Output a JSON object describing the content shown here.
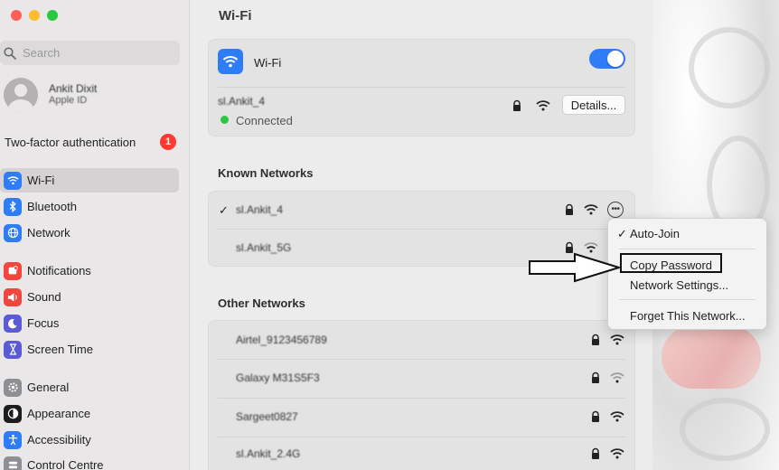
{
  "sidebar": {
    "search_placeholder": "Search",
    "profile": {
      "name": "Ankit Dixit",
      "subtitle": "Apple ID"
    },
    "two_factor": {
      "label": "Two-factor authentication",
      "badge": "1"
    },
    "items": [
      {
        "label": "Wi-Fi",
        "icon": "wifi-icon",
        "color": "#2f7df6"
      },
      {
        "label": "Bluetooth",
        "icon": "bluetooth-icon",
        "color": "#2f7df6"
      },
      {
        "label": "Network",
        "icon": "globe-icon",
        "color": "#2f7df6"
      },
      {
        "label": "Notifications",
        "icon": "bell-icon",
        "color": "#f0463e"
      },
      {
        "label": "Sound",
        "icon": "speaker-icon",
        "color": "#f0463e"
      },
      {
        "label": "Focus",
        "icon": "moon-icon",
        "color": "#5b5bd6"
      },
      {
        "label": "Screen Time",
        "icon": "hourglass-icon",
        "color": "#5b5bd6"
      },
      {
        "label": "General",
        "icon": "gear-icon",
        "color": "#8e8e93"
      },
      {
        "label": "Appearance",
        "icon": "appearance-icon",
        "color": "#1c1c1e"
      },
      {
        "label": "Accessibility",
        "icon": "accessibility-icon",
        "color": "#2f7df6"
      },
      {
        "label": "Control Centre",
        "icon": "control-centre-icon",
        "color": "#8e8e93"
      }
    ]
  },
  "main": {
    "title": "Wi-Fi",
    "wifi_toggle_label": "Wi-Fi",
    "wifi_enabled": true,
    "current_network": {
      "name": "sl.Ankit_4",
      "status": "Connected",
      "details_label": "Details..."
    },
    "known_networks_heading": "Known Networks",
    "known_networks": [
      {
        "name": "sl.Ankit_4",
        "checked": true
      },
      {
        "name": "sl.Ankit_5G",
        "checked": false
      }
    ],
    "other_networks_heading": "Other Networks",
    "other_networks": [
      {
        "name": "Airtel_9123456789"
      },
      {
        "name": "Galaxy M31S5F3"
      },
      {
        "name": "Sargeet0827"
      },
      {
        "name": "sl.Ankit_2.4G"
      }
    ]
  },
  "context_menu": {
    "items": [
      {
        "label": "Auto-Join",
        "checked": true
      },
      {
        "label": "Copy Password",
        "checked": false
      },
      {
        "label": "Network Settings...",
        "checked": false
      },
      {
        "label": "Forget This Network...",
        "checked": false
      }
    ]
  },
  "colors": {
    "accent": "#2f7df6",
    "connected": "#28c840",
    "badge": "#ff3b30"
  }
}
